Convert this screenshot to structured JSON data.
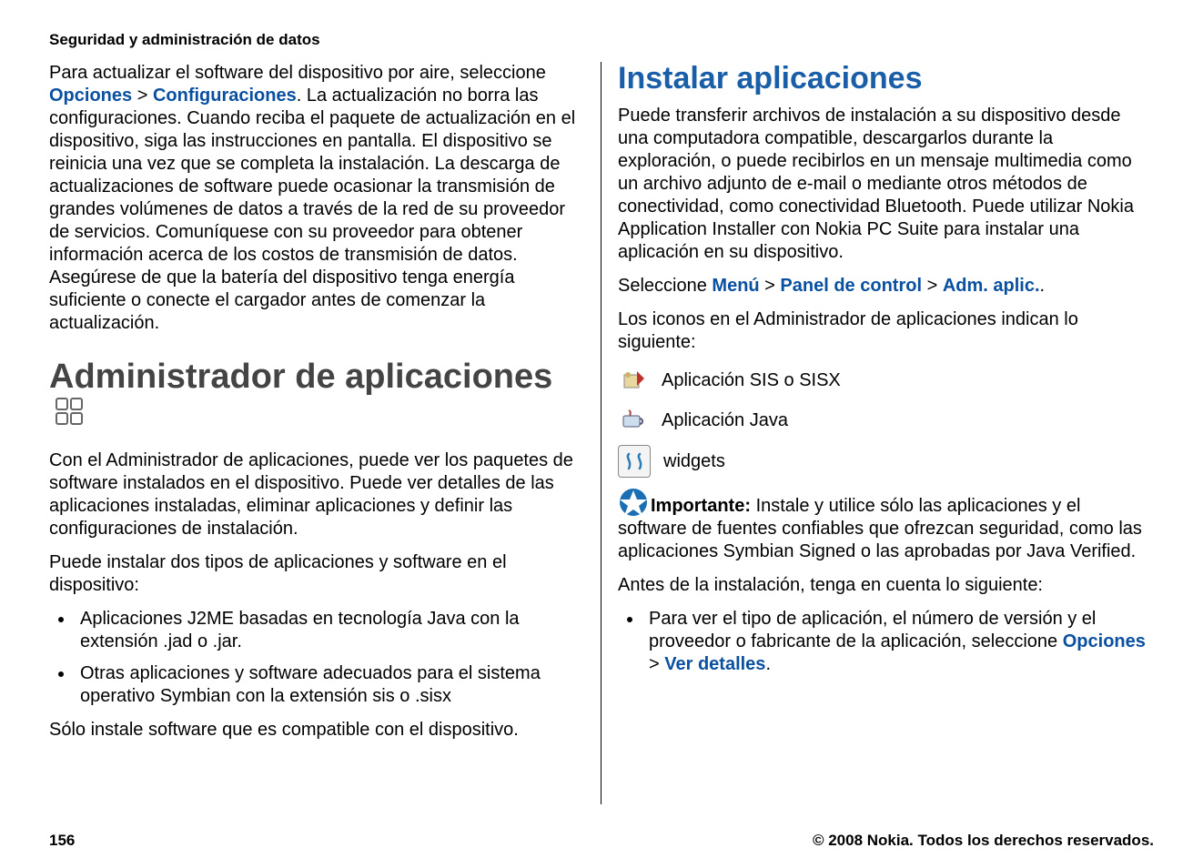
{
  "header": {
    "section_title": "Seguridad y administración de datos"
  },
  "left": {
    "p1_pre": "Para actualizar el software del dispositivo por aire, seleccione ",
    "p1_link1": "Opciones",
    "p1_gt1": " > ",
    "p1_link2": "Configuraciones",
    "p1_post": ". La actualización no borra las configuraciones. Cuando reciba el paquete de actualización en el dispositivo, siga las instrucciones en pantalla. El dispositivo se reinicia una vez que se completa la instalación. La descarga de actualizaciones de software puede ocasionar la transmisión de grandes volúmenes de datos a través de la red de su proveedor de servicios. Comuníquese con su proveedor para obtener información acerca de los costos de transmisión de datos. Asegúrese de que la batería del dispositivo tenga energía suficiente o conecte el cargador antes de comenzar la actualización.",
    "h1": "Administrador de aplicaciones",
    "p2": "Con el Administrador de aplicaciones, puede ver los paquetes de software instalados en el dispositivo. Puede ver detalles de las aplicaciones instaladas, eliminar aplicaciones y definir las configuraciones de instalación.",
    "p3": "Puede instalar dos tipos de aplicaciones y software en el dispositivo:",
    "bullets": [
      "Aplicaciones J2ME basadas en tecnología Java con la extensión .jad o .jar.",
      "Otras aplicaciones y software adecuados para el sistema operativo Symbian con la extensión sis o .sisx"
    ],
    "p4": "Sólo instale software que es compatible con el dispositivo."
  },
  "right": {
    "h2": "Instalar aplicaciones",
    "p1": "Puede transferir archivos de instalación a su dispositivo desde una computadora compatible, descargarlos durante la exploración, o puede recibirlos en un mensaje multimedia como un archivo adjunto de e-mail o mediante otros métodos de conectividad, como conectividad Bluetooth. Puede utilizar Nokia Application Installer con Nokia PC Suite para instalar una aplicación en su dispositivo.",
    "p2_pre": "Seleccione ",
    "p2_link1": "Menú",
    "p2_gt1": " > ",
    "p2_link2": "Panel de control",
    "p2_gt2": " > ",
    "p2_link3": "Adm. aplic.",
    "p2_post": ".",
    "p3": "Los iconos en el Administrador de aplicaciones indican lo siguiente:",
    "icons": [
      {
        "name": "sis-icon",
        "label": "Aplicación SIS o SISX"
      },
      {
        "name": "java-icon",
        "label": "Aplicación Java"
      },
      {
        "name": "widget-icon",
        "label": "widgets"
      }
    ],
    "important_label": "Importante:  ",
    "important_text": "Instale y utilice sólo las aplicaciones y el software de fuentes confiables que ofrezcan seguridad, como las aplicaciones Symbian Signed o las aprobadas por Java Verified.",
    "p4": "Antes de la instalación, tenga en cuenta lo siguiente:",
    "bullets2_pre": "Para ver el tipo de aplicación, el número de versión y el proveedor o fabricante de la aplicación, seleccione ",
    "bullets2_link1": "Opciones",
    "bullets2_gt1": " > ",
    "bullets2_link2": "Ver detalles",
    "bullets2_post": "."
  },
  "footer": {
    "page_number": "156",
    "copyright": "© 2008 Nokia. Todos los derechos reservados."
  }
}
